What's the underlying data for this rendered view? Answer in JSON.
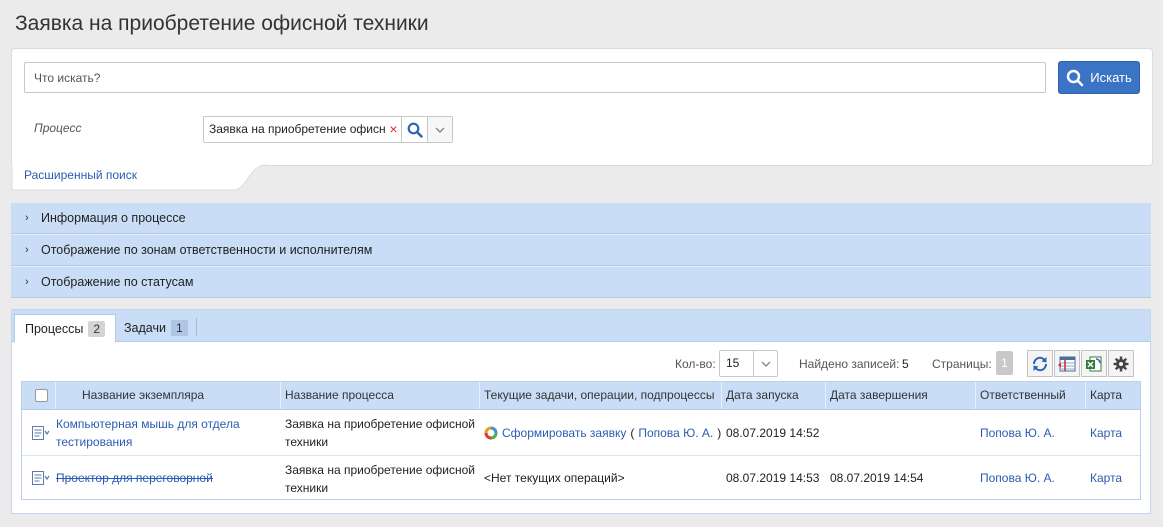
{
  "page": {
    "title": "Заявка на приобретение офисной техники"
  },
  "search": {
    "placeholder": "Что искать?",
    "button_label": "Искать",
    "process_label": "Процесс",
    "process_value": "Заявка на приобретение офисн",
    "clear_symbol": "×",
    "advanced_link": "Расширенный поиск"
  },
  "accordions": [
    {
      "label": "Информация о процессе"
    },
    {
      "label": "Отображение по зонам ответственности и исполнителям"
    },
    {
      "label": "Отображение по статусам"
    }
  ],
  "tabs": [
    {
      "label": "Процессы",
      "count": "2",
      "active": true
    },
    {
      "label": "Задачи",
      "count": "1",
      "active": false
    }
  ],
  "pager": {
    "qty_label": "Кол-во:",
    "qty_value": "15",
    "found_label": "Найдено записей:",
    "found_count": "5",
    "pages_label": "Страницы:",
    "pages_value": "1"
  },
  "toolbar": {
    "icons": [
      "refresh-icon",
      "column-settings-icon",
      "excel-export-icon",
      "gear-icon"
    ]
  },
  "table": {
    "columns": [
      "Название экземпляра",
      "Название процесса",
      "Текущие задачи, операции, подпроцессы",
      "Дата запуска",
      "Дата завершения",
      "Ответственный",
      "Карта"
    ],
    "rows": [
      {
        "instance": "Компьютерная мышь для отдела тестирования",
        "process": "Заявка на приобретение офисной техники",
        "task_link": "Сформировать заявку",
        "task_open": " (",
        "task_user": "Попова Ю. А.",
        "task_close": ")",
        "started": "08.07.2019 14:52",
        "finished": "",
        "responsible": "Попова Ю. А.",
        "map": "Карта"
      },
      {
        "instance": "Проектор для переговорной",
        "process": "Заявка на приобретение офисной техники",
        "task_text": "<Нет текущих операций>",
        "started": "08.07.2019 14:53",
        "finished": "08.07.2019 14:54",
        "responsible": "Попова Ю. А.",
        "map": "Карта"
      }
    ]
  },
  "colors": {
    "accent": "#3b74c4",
    "link": "#2a5db0",
    "panel_blue": "#c9ddf6",
    "clear_red": "#dd3333"
  }
}
